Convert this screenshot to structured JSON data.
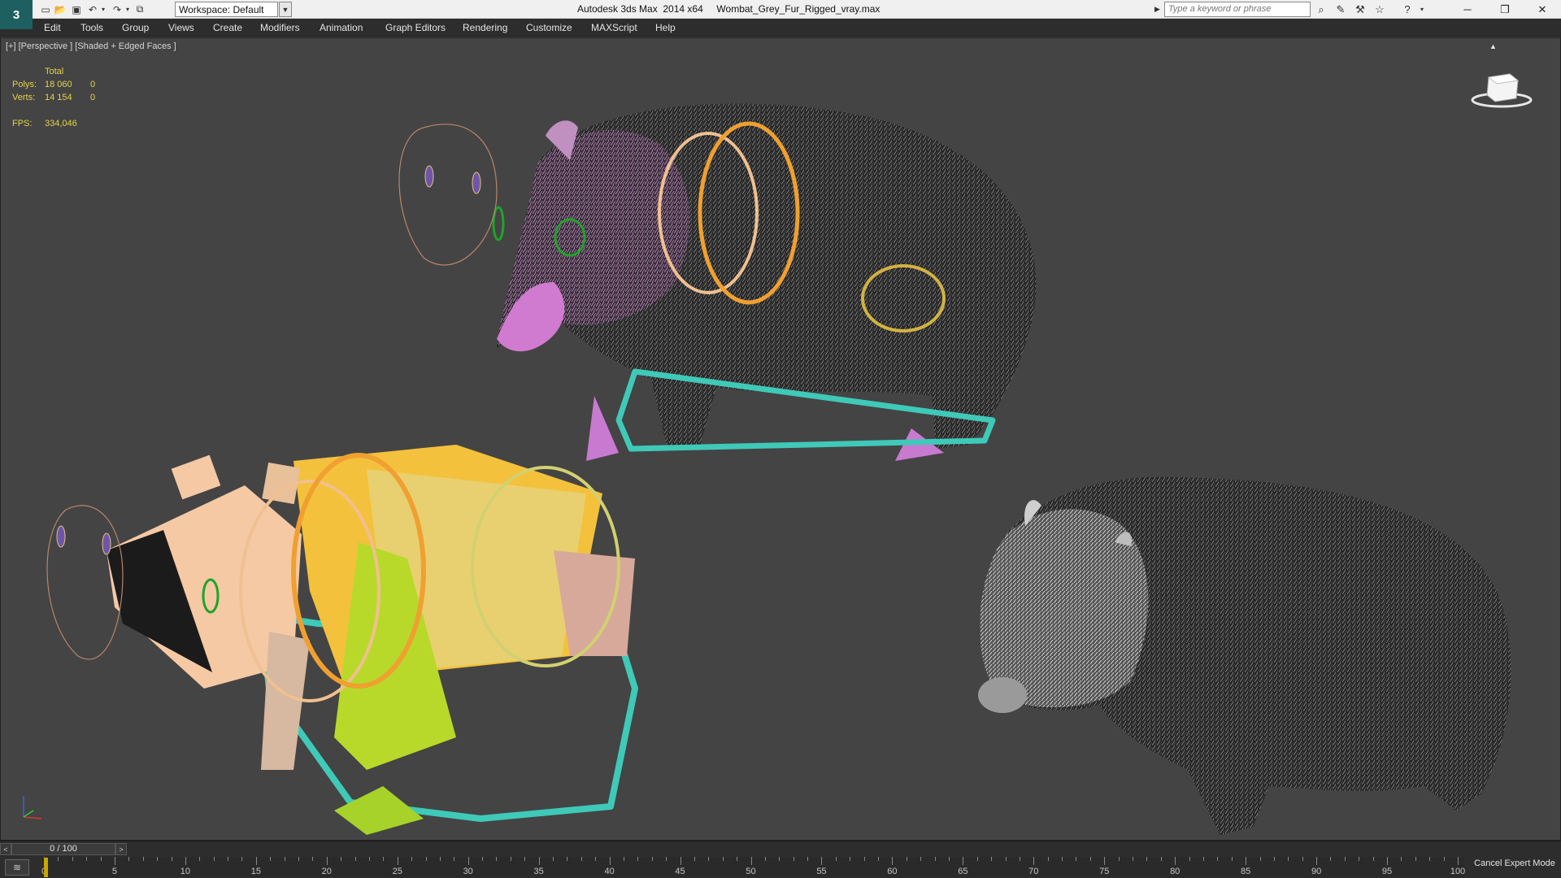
{
  "titlebar": {
    "app_title": "Autodesk 3ds Max  2014 x64     Wombat_Grey_Fur_Rigged_vray.max",
    "workspace": "Workspace: Default",
    "search_placeholder": "Type a keyword or phrase"
  },
  "menu": [
    "Edit",
    "Tools",
    "Group",
    "Views",
    "Create",
    "Modifiers",
    "Animation",
    "Graph Editors",
    "Rendering",
    "Customize",
    "MAXScript",
    "Help"
  ],
  "viewport": {
    "label": "[+] [Perspective ] [Shaded + Edged Faces ]",
    "stats": {
      "header": "Total",
      "polys_label": "Polys:",
      "polys_total": "18 060",
      "polys_sel": "0",
      "verts_label": "Verts:",
      "verts_total": "14 154",
      "verts_sel": "0",
      "fps_label": "FPS:",
      "fps_value": "334,046"
    }
  },
  "timeline": {
    "slider_text": "0 / 100",
    "frame_labels": [
      "0",
      "5",
      "10",
      "15",
      "20",
      "25",
      "30",
      "35",
      "40",
      "45",
      "50",
      "55",
      "60",
      "65",
      "70",
      "75",
      "80",
      "85",
      "90",
      "95",
      "100"
    ],
    "current_frame": 0
  },
  "status": {
    "cancel_expert_mode": "Cancel Expert Mode"
  },
  "colors": {
    "viewport_bg": "#444444",
    "stats_text": "#e3d34a",
    "rig_orange": "#f0a030",
    "rig_teal": "#3fc9b8",
    "rig_green": "#1fa32a"
  }
}
